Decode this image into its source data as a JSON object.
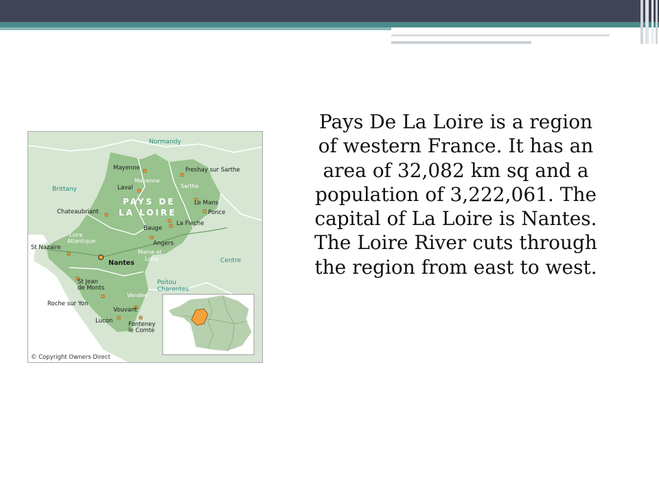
{
  "slide": {
    "body": "Pays De La Loire is a region of western France. It has an area of 32,082 km sq and a population of 3,222,061. The capital of La Loire is Nantes. The Loire River cuts through the region from east to west."
  },
  "map": {
    "regions": {
      "normandy": "Normandy",
      "brittany": "Brittany",
      "centre": "Centre",
      "poitou": "Poitou",
      "charentes": "Charentes",
      "region_name_1": "PAYS DE",
      "region_name_2": "LA LOIRE"
    },
    "departments": {
      "mayenne": "Mayenne",
      "sarthe": "Sarthe",
      "loire_1": "Loire",
      "loire_2": "Atlantique",
      "maine_1": "Maine et",
      "maine_2": "Loire",
      "vendee": "Vendee"
    },
    "towns": {
      "mayenne": "Mayenne",
      "laval": "Laval",
      "fresnay": "Freshay sur Sarthe",
      "le_mans": "Le Mans",
      "ponce": "Ponce",
      "chateaubriant": "Chateaubriant",
      "bauge": "Bauge",
      "la_fleche": "La Fleche",
      "angers": "Angers",
      "st_nazaire": "St Nazaire",
      "nantes": "Nantes",
      "st_jean_1": "St Jean",
      "st_jean_2": "de Monts",
      "roche": "Roche sur Yon",
      "vouvant": "Vouvant",
      "lucon": "Lucon",
      "fontenay_1": "Fonteney",
      "fontenay_2": "le Comte"
    },
    "copyright": "© Copyright Owners Direct",
    "colors": {
      "region_fill": "#98c28e",
      "land_fill": "#d6e6d2",
      "sea_fill": "#ffffff",
      "town_marker": "#f4a23a",
      "label_teal": "#2e8a7c",
      "label_white": "#ffffff"
    }
  }
}
